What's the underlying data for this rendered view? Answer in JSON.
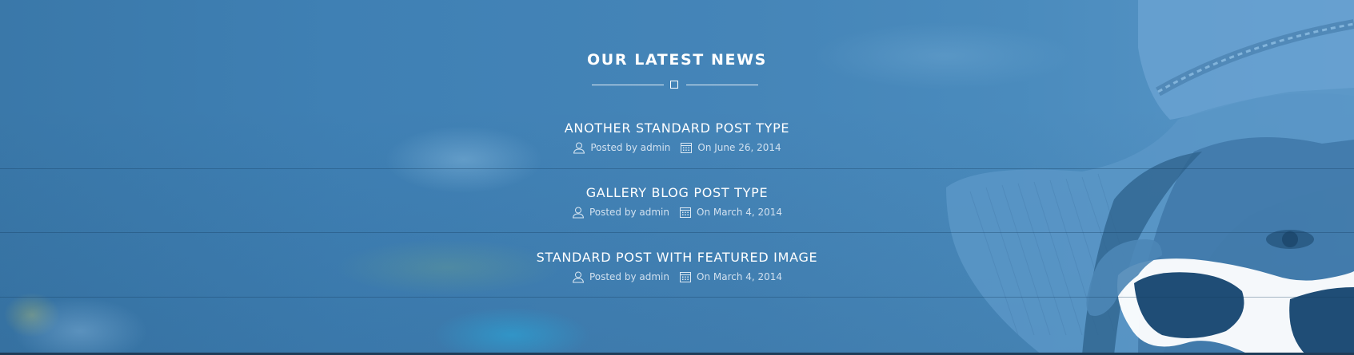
{
  "section": {
    "heading": "OUR LATEST NEWS"
  },
  "posts": [
    {
      "title": "ANOTHER STANDARD POST TYPE",
      "author_label": "Posted by admin",
      "date_label": "On June 26, 2014"
    },
    {
      "title": "GALLERY BLOG POST TYPE",
      "author_label": "Posted by admin",
      "date_label": "On March 4, 2014"
    },
    {
      "title": "STANDARD POST WITH FEATURED IMAGE",
      "author_label": "Posted by admin",
      "date_label": "On March 4, 2014"
    }
  ],
  "icons": {
    "author": "user-icon",
    "date": "calendar-icon"
  },
  "colors": {
    "overlay": "#4585b8",
    "text": "#ffffff",
    "meta": "#dbe8f3"
  }
}
